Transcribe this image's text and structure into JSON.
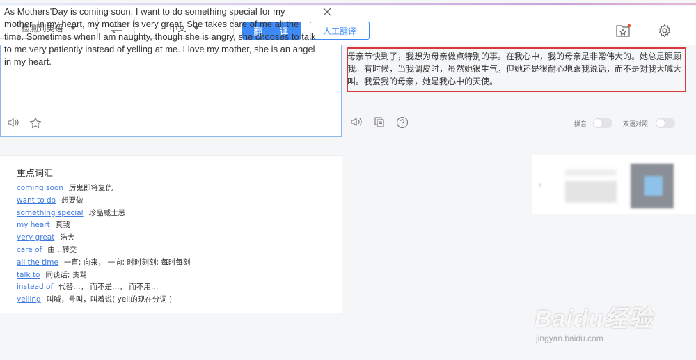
{
  "toolbar": {
    "source_lang": "检测到英语",
    "target_lang": "中文",
    "translate_label": "翻 译",
    "human_translate_label": "人工翻译"
  },
  "source": {
    "text": "As Mothers'Day is coming soon, I want to do something special for my mother. In my heart, my mother is very great. She takes care of me all the time. Sometimes when I am naughty, though she is angry, she chooses to talk to me very patiently instead of yelling at me. I love my mother, she is an angel in my heart."
  },
  "target": {
    "text": "母亲节快到了，我想为母亲做点特别的事。在我心中，我的母亲是非常伟大的。她总是照顾我。有时候，当我调皮时，虽然她很生气，但她还是很耐心地跟我说话，而不是对我大喊大叫。我爱我的母亲，她是我心中的天使。",
    "pinyin_label": "拼音",
    "bilingual_label": "双语对照",
    "highlight_color": "#d9363e"
  },
  "vocab": {
    "title": "重点词汇",
    "items": [
      {
        "term": "coming soon",
        "def": "厉鬼即将复仇"
      },
      {
        "term": "want to do",
        "def": "想要做"
      },
      {
        "term": "something special",
        "def": "珍品威士忌"
      },
      {
        "term": "my heart",
        "def": "真我"
      },
      {
        "term": "very great",
        "def": "浩大"
      },
      {
        "term": "care of",
        "def": "由…转交"
      },
      {
        "term": "all the time",
        "def": "一直; 向来， 一向; 时时刻刻; 每时每刻"
      },
      {
        "term": "talk to",
        "def": "同谈话; 责骂"
      },
      {
        "term": "instead of",
        "def": "代替…， 而不是…， 而不用…"
      },
      {
        "term": "yelling",
        "def": "叫喊，号叫，叫着说( yell的现在分词 )"
      }
    ]
  },
  "watermark": {
    "main": "Baidu经验",
    "sub": "jingyan.baidu.com"
  },
  "colors": {
    "accent": "#3d8af7",
    "link": "#3d7be0"
  },
  "icons": [
    "swap-icon",
    "favorites-icon",
    "settings-icon",
    "close-icon",
    "speaker-icon",
    "star-icon",
    "copy-icon",
    "help-icon",
    "chevron-down-icon",
    "chevron-left-icon"
  ]
}
